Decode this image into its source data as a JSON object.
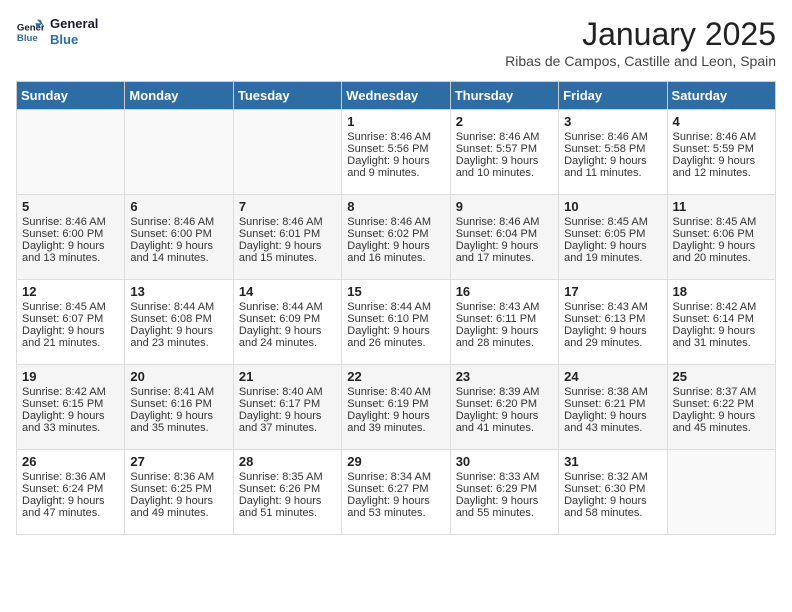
{
  "header": {
    "logo_line1": "General",
    "logo_line2": "Blue",
    "month_title": "January 2025",
    "location": "Ribas de Campos, Castille and Leon, Spain"
  },
  "days_of_week": [
    "Sunday",
    "Monday",
    "Tuesday",
    "Wednesday",
    "Thursday",
    "Friday",
    "Saturday"
  ],
  "weeks": [
    [
      {
        "day": "",
        "info": ""
      },
      {
        "day": "",
        "info": ""
      },
      {
        "day": "",
        "info": ""
      },
      {
        "day": "1",
        "info": "Sunrise: 8:46 AM\nSunset: 5:56 PM\nDaylight: 9 hours\nand 9 minutes."
      },
      {
        "day": "2",
        "info": "Sunrise: 8:46 AM\nSunset: 5:57 PM\nDaylight: 9 hours\nand 10 minutes."
      },
      {
        "day": "3",
        "info": "Sunrise: 8:46 AM\nSunset: 5:58 PM\nDaylight: 9 hours\nand 11 minutes."
      },
      {
        "day": "4",
        "info": "Sunrise: 8:46 AM\nSunset: 5:59 PM\nDaylight: 9 hours\nand 12 minutes."
      }
    ],
    [
      {
        "day": "5",
        "info": "Sunrise: 8:46 AM\nSunset: 6:00 PM\nDaylight: 9 hours\nand 13 minutes."
      },
      {
        "day": "6",
        "info": "Sunrise: 8:46 AM\nSunset: 6:00 PM\nDaylight: 9 hours\nand 14 minutes."
      },
      {
        "day": "7",
        "info": "Sunrise: 8:46 AM\nSunset: 6:01 PM\nDaylight: 9 hours\nand 15 minutes."
      },
      {
        "day": "8",
        "info": "Sunrise: 8:46 AM\nSunset: 6:02 PM\nDaylight: 9 hours\nand 16 minutes."
      },
      {
        "day": "9",
        "info": "Sunrise: 8:46 AM\nSunset: 6:04 PM\nDaylight: 9 hours\nand 17 minutes."
      },
      {
        "day": "10",
        "info": "Sunrise: 8:45 AM\nSunset: 6:05 PM\nDaylight: 9 hours\nand 19 minutes."
      },
      {
        "day": "11",
        "info": "Sunrise: 8:45 AM\nSunset: 6:06 PM\nDaylight: 9 hours\nand 20 minutes."
      }
    ],
    [
      {
        "day": "12",
        "info": "Sunrise: 8:45 AM\nSunset: 6:07 PM\nDaylight: 9 hours\nand 21 minutes."
      },
      {
        "day": "13",
        "info": "Sunrise: 8:44 AM\nSunset: 6:08 PM\nDaylight: 9 hours\nand 23 minutes."
      },
      {
        "day": "14",
        "info": "Sunrise: 8:44 AM\nSunset: 6:09 PM\nDaylight: 9 hours\nand 24 minutes."
      },
      {
        "day": "15",
        "info": "Sunrise: 8:44 AM\nSunset: 6:10 PM\nDaylight: 9 hours\nand 26 minutes."
      },
      {
        "day": "16",
        "info": "Sunrise: 8:43 AM\nSunset: 6:11 PM\nDaylight: 9 hours\nand 28 minutes."
      },
      {
        "day": "17",
        "info": "Sunrise: 8:43 AM\nSunset: 6:13 PM\nDaylight: 9 hours\nand 29 minutes."
      },
      {
        "day": "18",
        "info": "Sunrise: 8:42 AM\nSunset: 6:14 PM\nDaylight: 9 hours\nand 31 minutes."
      }
    ],
    [
      {
        "day": "19",
        "info": "Sunrise: 8:42 AM\nSunset: 6:15 PM\nDaylight: 9 hours\nand 33 minutes."
      },
      {
        "day": "20",
        "info": "Sunrise: 8:41 AM\nSunset: 6:16 PM\nDaylight: 9 hours\nand 35 minutes."
      },
      {
        "day": "21",
        "info": "Sunrise: 8:40 AM\nSunset: 6:17 PM\nDaylight: 9 hours\nand 37 minutes."
      },
      {
        "day": "22",
        "info": "Sunrise: 8:40 AM\nSunset: 6:19 PM\nDaylight: 9 hours\nand 39 minutes."
      },
      {
        "day": "23",
        "info": "Sunrise: 8:39 AM\nSunset: 6:20 PM\nDaylight: 9 hours\nand 41 minutes."
      },
      {
        "day": "24",
        "info": "Sunrise: 8:38 AM\nSunset: 6:21 PM\nDaylight: 9 hours\nand 43 minutes."
      },
      {
        "day": "25",
        "info": "Sunrise: 8:37 AM\nSunset: 6:22 PM\nDaylight: 9 hours\nand 45 minutes."
      }
    ],
    [
      {
        "day": "26",
        "info": "Sunrise: 8:36 AM\nSunset: 6:24 PM\nDaylight: 9 hours\nand 47 minutes."
      },
      {
        "day": "27",
        "info": "Sunrise: 8:36 AM\nSunset: 6:25 PM\nDaylight: 9 hours\nand 49 minutes."
      },
      {
        "day": "28",
        "info": "Sunrise: 8:35 AM\nSunset: 6:26 PM\nDaylight: 9 hours\nand 51 minutes."
      },
      {
        "day": "29",
        "info": "Sunrise: 8:34 AM\nSunset: 6:27 PM\nDaylight: 9 hours\nand 53 minutes."
      },
      {
        "day": "30",
        "info": "Sunrise: 8:33 AM\nSunset: 6:29 PM\nDaylight: 9 hours\nand 55 minutes."
      },
      {
        "day": "31",
        "info": "Sunrise: 8:32 AM\nSunset: 6:30 PM\nDaylight: 9 hours\nand 58 minutes."
      },
      {
        "day": "",
        "info": ""
      }
    ]
  ]
}
